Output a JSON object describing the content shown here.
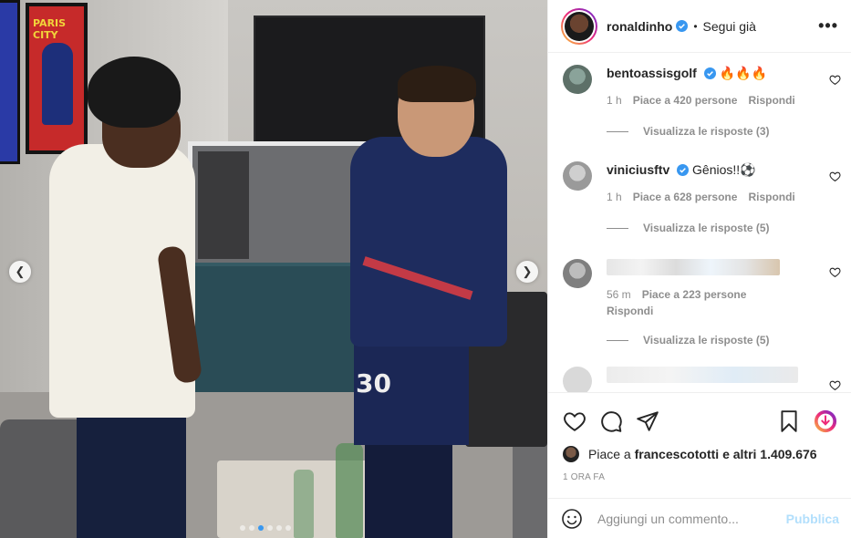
{
  "header": {
    "username": "ronaldinho",
    "separator": "•",
    "follow_status": "Segui già",
    "more_label": "•••"
  },
  "comments": [
    {
      "username": "bentoassisgolf",
      "text": "🔥🔥🔥",
      "time": "1 h",
      "likes": "Piace a 420 persone",
      "reply": "Rispondi",
      "view_replies": "Visualizza le risposte (3)"
    },
    {
      "username": "viniciusftv",
      "text": "Gênios!!⚽",
      "time": "1 h",
      "likes": "Piace a 628 persone",
      "reply": "Rispondi",
      "view_replies": "Visualizza le risposte (5)"
    },
    {
      "username": "",
      "text": "",
      "time": "56 m",
      "likes": "Piace a 223 persone",
      "reply": "Rispondi",
      "view_replies": "Visualizza le risposte (5)"
    }
  ],
  "likes_summary": {
    "prefix": "Piace a",
    "user": "francescototti",
    "suffix": "e altri 1.409.676"
  },
  "post_time": "1 ORA FA",
  "add_comment": {
    "placeholder": "Aggiungi un commento...",
    "post_label": "Pubblica"
  },
  "photo": {
    "poster_text": "PARIS CITY",
    "shorts_number": "30",
    "carousel_count": 6,
    "carousel_active": 3
  },
  "colors": {
    "verified": "#3897f0",
    "muted": "#8e8e8e",
    "post_disabled": "#b2dffc",
    "text": "#262626"
  }
}
